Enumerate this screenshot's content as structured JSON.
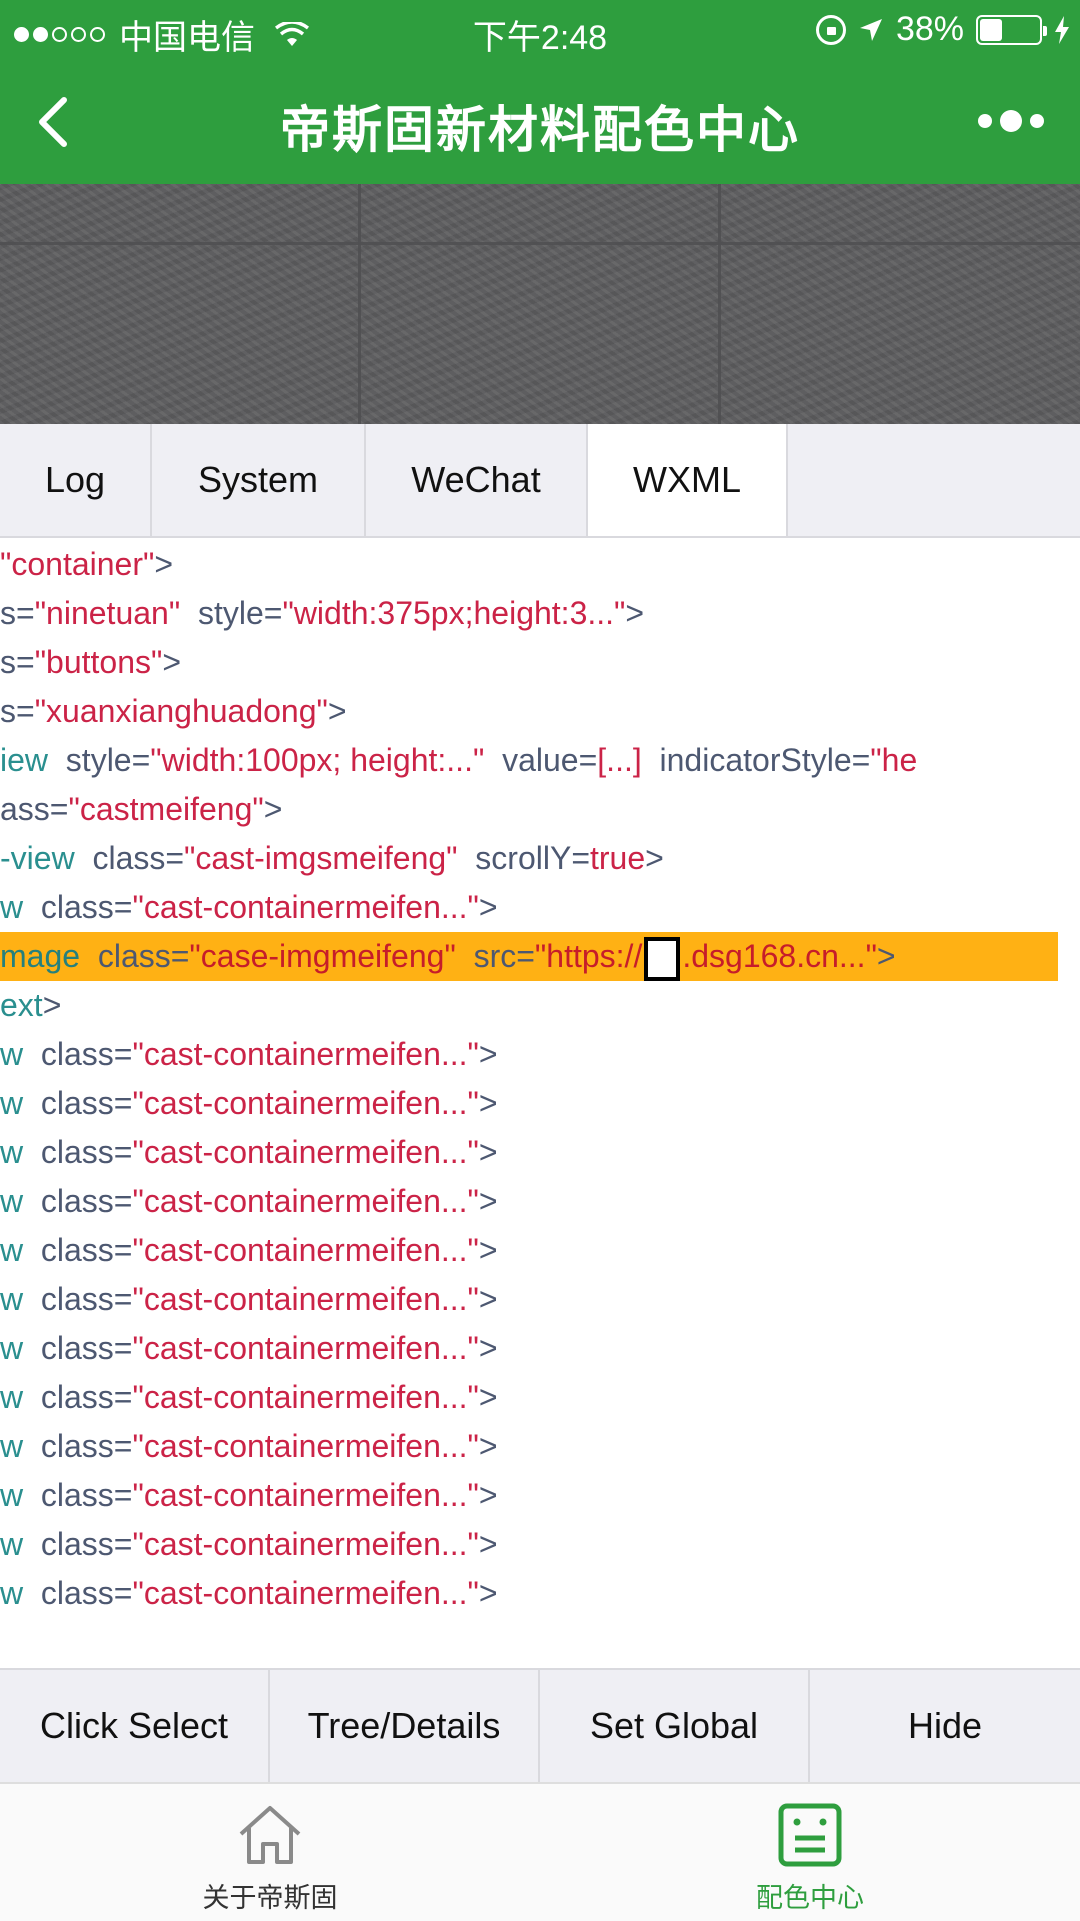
{
  "status_bar": {
    "carrier": "中国电信",
    "time": "下午2:48",
    "battery": "38%",
    "battery_level": 0.38,
    "signal_bars_filled": 2,
    "signal_bars_total": 5
  },
  "nav": {
    "title": "帝斯固新材料配色中心",
    "back_icon": "chevron-left-icon",
    "more_icon": "more-dots-icon"
  },
  "banner": {
    "description_icon": "stone-texture"
  },
  "console_tabs": [
    {
      "label": "Log",
      "active": false
    },
    {
      "label": "System",
      "active": false
    },
    {
      "label": "WeChat",
      "active": false
    },
    {
      "label": "WXML",
      "active": true
    }
  ],
  "wxml_lines": [
    {
      "highlighted": false,
      "tokens": [
        [
          "val",
          "\"container\""
        ],
        [
          "p",
          ">"
        ]
      ]
    },
    {
      "highlighted": false,
      "tokens": [
        [
          "attr",
          "s="
        ],
        [
          "val",
          "\"ninetuan\""
        ],
        [
          "attr",
          "  style="
        ],
        [
          "val",
          "\"width:375px;height:3...\""
        ],
        [
          "p",
          ">"
        ]
      ]
    },
    {
      "highlighted": false,
      "tokens": [
        [
          "attr",
          "s="
        ],
        [
          "val",
          "\"buttons\""
        ],
        [
          "p",
          ">"
        ]
      ]
    },
    {
      "highlighted": false,
      "tokens": [
        [
          "attr",
          "s="
        ],
        [
          "val",
          "\"xuanxianghuadong\""
        ],
        [
          "p",
          ">"
        ]
      ]
    },
    {
      "highlighted": false,
      "tokens": [
        [
          "tag",
          "iew"
        ],
        [
          "attr",
          "  style="
        ],
        [
          "val",
          "\"width:100px; height:...\""
        ],
        [
          "attr",
          "  value="
        ],
        [
          "val",
          "[...]"
        ],
        [
          "attr",
          "  indicatorStyle="
        ],
        [
          "val",
          "\"he"
        ]
      ]
    },
    {
      "highlighted": false,
      "tokens": [
        [
          "attr",
          "ass="
        ],
        [
          "val",
          "\"castmeifeng\""
        ],
        [
          "p",
          ">"
        ]
      ]
    },
    {
      "highlighted": false,
      "tokens": [
        [
          "tag",
          "-view"
        ],
        [
          "attr",
          "  class="
        ],
        [
          "val",
          "\"cast-imgsmeifeng\""
        ],
        [
          "attr",
          "  scrollY="
        ],
        [
          "val",
          "true"
        ],
        [
          "p",
          ">"
        ]
      ]
    },
    {
      "highlighted": false,
      "tokens": [
        [
          "tag",
          "w"
        ],
        [
          "attr",
          "  class="
        ],
        [
          "val",
          "\"cast-containermeifen...\""
        ],
        [
          "p",
          ">"
        ]
      ]
    },
    {
      "highlighted": true,
      "tokens": [
        [
          "tag",
          "mage"
        ],
        [
          "attr",
          "  class="
        ],
        [
          "val",
          "\"case-imgmeifeng\""
        ],
        [
          "attr",
          "  src="
        ],
        [
          "val",
          "\"https://"
        ],
        [
          "box",
          ""
        ],
        [
          "val",
          ".dsg168.cn...\""
        ],
        [
          "p",
          ">"
        ]
      ]
    },
    {
      "highlighted": false,
      "tokens": [
        [
          "tag",
          "ext"
        ],
        [
          "p",
          ">"
        ]
      ]
    },
    {
      "highlighted": false,
      "tokens": [
        [
          "tag",
          "w"
        ],
        [
          "attr",
          "  class="
        ],
        [
          "val",
          "\"cast-containermeifen...\""
        ],
        [
          "p",
          ">"
        ]
      ]
    },
    {
      "highlighted": false,
      "tokens": [
        [
          "tag",
          "w"
        ],
        [
          "attr",
          "  class="
        ],
        [
          "val",
          "\"cast-containermeifen...\""
        ],
        [
          "p",
          ">"
        ]
      ]
    },
    {
      "highlighted": false,
      "tokens": [
        [
          "tag",
          "w"
        ],
        [
          "attr",
          "  class="
        ],
        [
          "val",
          "\"cast-containermeifen...\""
        ],
        [
          "p",
          ">"
        ]
      ]
    },
    {
      "highlighted": false,
      "tokens": [
        [
          "tag",
          "w"
        ],
        [
          "attr",
          "  class="
        ],
        [
          "val",
          "\"cast-containermeifen...\""
        ],
        [
          "p",
          ">"
        ]
      ]
    },
    {
      "highlighted": false,
      "tokens": [
        [
          "tag",
          "w"
        ],
        [
          "attr",
          "  class="
        ],
        [
          "val",
          "\"cast-containermeifen...\""
        ],
        [
          "p",
          ">"
        ]
      ]
    },
    {
      "highlighted": false,
      "tokens": [
        [
          "tag",
          "w"
        ],
        [
          "attr",
          "  class="
        ],
        [
          "val",
          "\"cast-containermeifen...\""
        ],
        [
          "p",
          ">"
        ]
      ]
    },
    {
      "highlighted": false,
      "tokens": [
        [
          "tag",
          "w"
        ],
        [
          "attr",
          "  class="
        ],
        [
          "val",
          "\"cast-containermeifen...\""
        ],
        [
          "p",
          ">"
        ]
      ]
    },
    {
      "highlighted": false,
      "tokens": [
        [
          "tag",
          "w"
        ],
        [
          "attr",
          "  class="
        ],
        [
          "val",
          "\"cast-containermeifen...\""
        ],
        [
          "p",
          ">"
        ]
      ]
    },
    {
      "highlighted": false,
      "tokens": [
        [
          "tag",
          "w"
        ],
        [
          "attr",
          "  class="
        ],
        [
          "val",
          "\"cast-containermeifen...\""
        ],
        [
          "p",
          ">"
        ]
      ]
    },
    {
      "highlighted": false,
      "tokens": [
        [
          "tag",
          "w"
        ],
        [
          "attr",
          "  class="
        ],
        [
          "val",
          "\"cast-containermeifen...\""
        ],
        [
          "p",
          ">"
        ]
      ]
    },
    {
      "highlighted": false,
      "tokens": [
        [
          "tag",
          "w"
        ],
        [
          "attr",
          "  class="
        ],
        [
          "val",
          "\"cast-containermeifen...\""
        ],
        [
          "p",
          ">"
        ]
      ]
    },
    {
      "highlighted": false,
      "tokens": [
        [
          "tag",
          "w"
        ],
        [
          "attr",
          "  class="
        ],
        [
          "val",
          "\"cast-containermeifen...\""
        ],
        [
          "p",
          ">"
        ]
      ]
    }
  ],
  "tool_buttons": [
    {
      "label": "Click Select"
    },
    {
      "label": "Tree/Details"
    },
    {
      "label": "Set Global"
    },
    {
      "label": "Hide"
    }
  ],
  "tabbar": [
    {
      "label": "关于帝斯固",
      "icon": "home-icon",
      "active": false,
      "color": "#333333"
    },
    {
      "label": "配色中心",
      "icon": "notepad-icon",
      "active": true,
      "color": "#2e9e3e"
    }
  ],
  "colors": {
    "nav_green": "#2e9e3e",
    "highlight": "#ffb114",
    "value_red": "#cb2347",
    "tag_teal": "#2a8f8f",
    "attr_slate": "#4d5871"
  }
}
